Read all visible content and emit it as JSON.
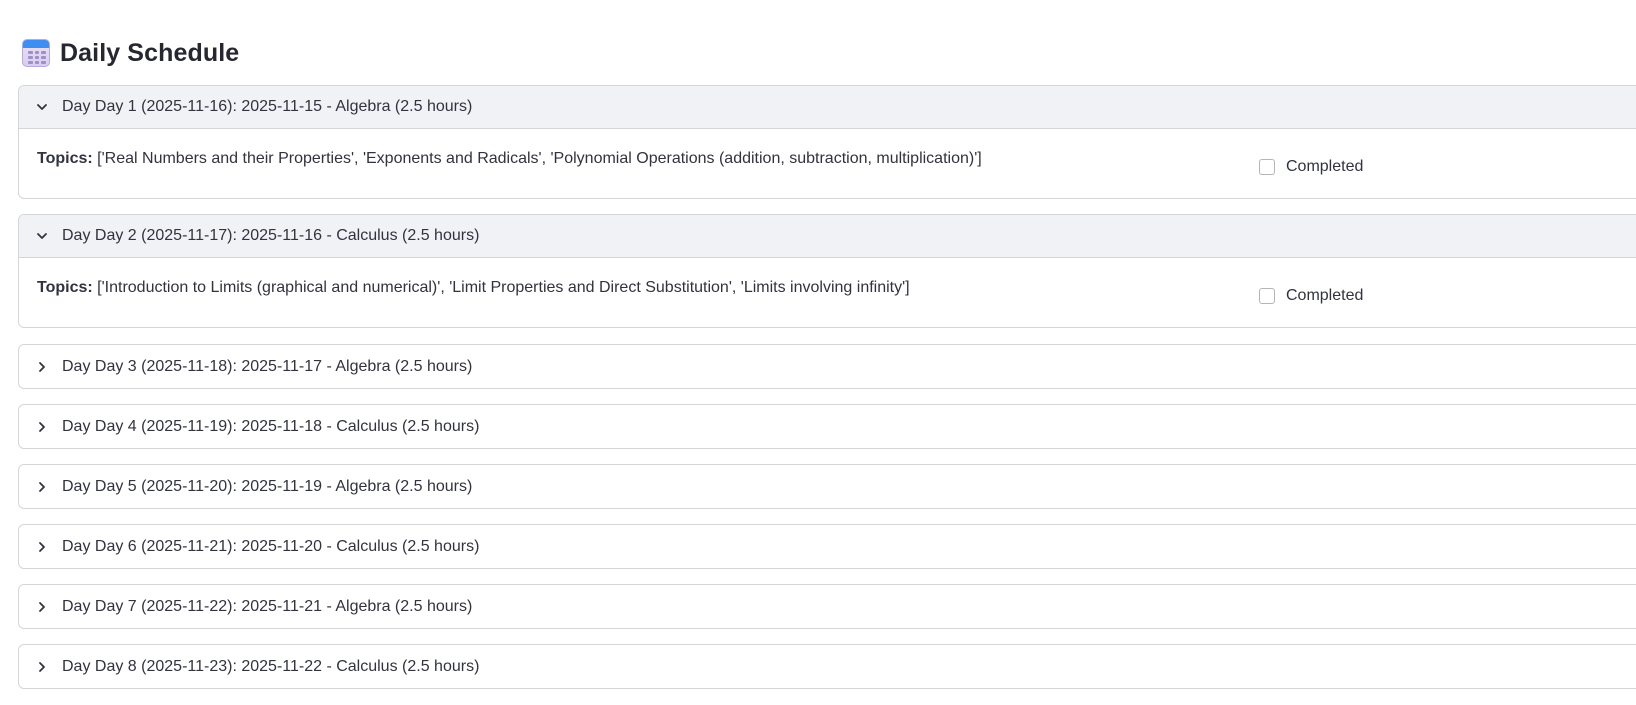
{
  "header": {
    "title": "Daily Schedule",
    "icon": "calendar-icon"
  },
  "days": [
    {
      "title": "Day Day 1 (2025-11-16): 2025-11-15 - Algebra (2.5 hours)",
      "expanded": true,
      "topics_label": "Topics:",
      "topics": "['Real Numbers and their Properties', 'Exponents and Radicals', 'Polynomial Operations (addition, subtraction, multiplication)']",
      "completed_label": "Completed",
      "completed": false
    },
    {
      "title": "Day Day 2 (2025-11-17): 2025-11-16 - Calculus (2.5 hours)",
      "expanded": true,
      "topics_label": "Topics:",
      "topics": "['Introduction to Limits (graphical and numerical)', 'Limit Properties and Direct Substitution', 'Limits involving infinity']",
      "completed_label": "Completed",
      "completed": false
    },
    {
      "title": "Day Day 3 (2025-11-18): 2025-11-17 - Algebra (2.5 hours)",
      "expanded": false
    },
    {
      "title": "Day Day 4 (2025-11-19): 2025-11-18 - Calculus (2.5 hours)",
      "expanded": false
    },
    {
      "title": "Day Day 5 (2025-11-20): 2025-11-19 - Algebra (2.5 hours)",
      "expanded": false
    },
    {
      "title": "Day Day 6 (2025-11-21): 2025-11-20 - Calculus (2.5 hours)",
      "expanded": false
    },
    {
      "title": "Day Day 7 (2025-11-22): 2025-11-21 - Algebra (2.5 hours)",
      "expanded": false
    },
    {
      "title": "Day Day 8 (2025-11-23): 2025-11-22 - Calculus (2.5 hours)",
      "expanded": false
    }
  ]
}
